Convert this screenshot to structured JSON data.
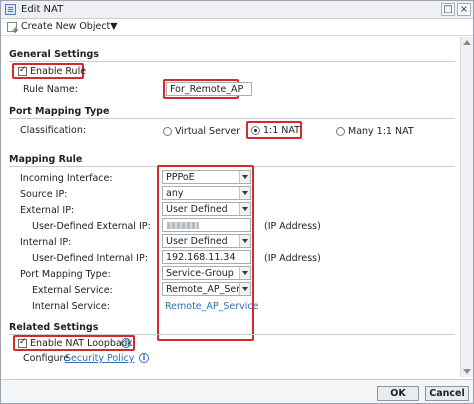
{
  "window": {
    "title": "Edit NAT"
  },
  "toolbar": {
    "create_label": "Create New Object▼"
  },
  "general": {
    "section_title": "General Settings",
    "enable_rule_label": "Enable Rule",
    "enable_rule_checked": true,
    "rule_name_label": "Rule Name:",
    "rule_name_value": "For_Remote_AP"
  },
  "port_mapping_type": {
    "section_title": "Port Mapping Type",
    "classification_label": "Classification:",
    "options": [
      "Virtual Server",
      "1:1 NAT",
      "Many 1:1 NAT"
    ],
    "selected": "1:1 NAT"
  },
  "mapping_rule": {
    "section_title": "Mapping Rule",
    "incoming_interface_label": "Incoming Interface:",
    "incoming_interface_value": "PPPoE",
    "source_ip_label": "Source IP:",
    "source_ip_value": "any",
    "external_ip_label": "External IP:",
    "external_ip_value": "User Defined",
    "user_external_ip_label": "User-Defined External IP:",
    "ip_address_hint": "(IP Address)",
    "internal_ip_label": "Internal IP:",
    "internal_ip_value": "User Defined",
    "user_internal_ip_label": "User-Defined Internal IP:",
    "user_internal_ip_value": "192.168.11.34",
    "port_mapping_type_label": "Port Mapping Type:",
    "port_mapping_type_value": "Service-Group",
    "external_service_label": "External Service:",
    "external_service_value": "Remote_AP_Servic",
    "internal_service_label": "Internal Service:",
    "internal_service_value": "Remote_AP_Service"
  },
  "related": {
    "section_title": "Related Settings",
    "loopback_label": "Enable NAT Loopback",
    "loopback_checked": true,
    "configure_label": "Configure",
    "security_policy_link": "Security Policy"
  },
  "footer": {
    "ok_label": "OK",
    "cancel_label": "Cancel"
  },
  "colors": {
    "highlight": "#d42a2a",
    "link": "#2f6fb5"
  }
}
